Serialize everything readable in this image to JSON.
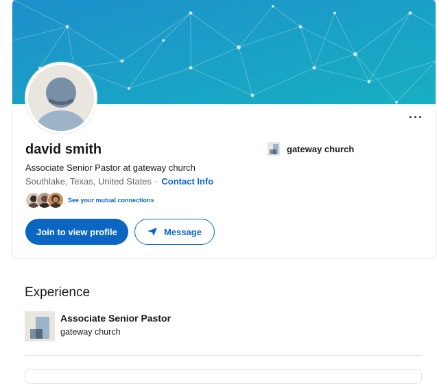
{
  "profile": {
    "name": "david smith",
    "headline": "Associate Senior Pastor at gateway church",
    "location": "Southlake, Texas, United States",
    "separator": "·",
    "contact_info": "Contact Info",
    "current_org": "gateway church",
    "more_label": "···"
  },
  "mutual": {
    "label": "See your mutual connections"
  },
  "actions": {
    "join_label": "Join to view profile",
    "message_label": "Message"
  },
  "experience": {
    "heading": "Experience",
    "items": [
      {
        "title": "Associate Senior Pastor",
        "organization": "gateway church"
      }
    ]
  },
  "colors": {
    "accent": "#0a66c2",
    "banner_start": "#1f95c9",
    "banner_end": "#15b3c0"
  },
  "icons": [
    "more-icon",
    "paper-plane-icon",
    "company-logo-icon",
    "avatar-placeholder-icon"
  ]
}
